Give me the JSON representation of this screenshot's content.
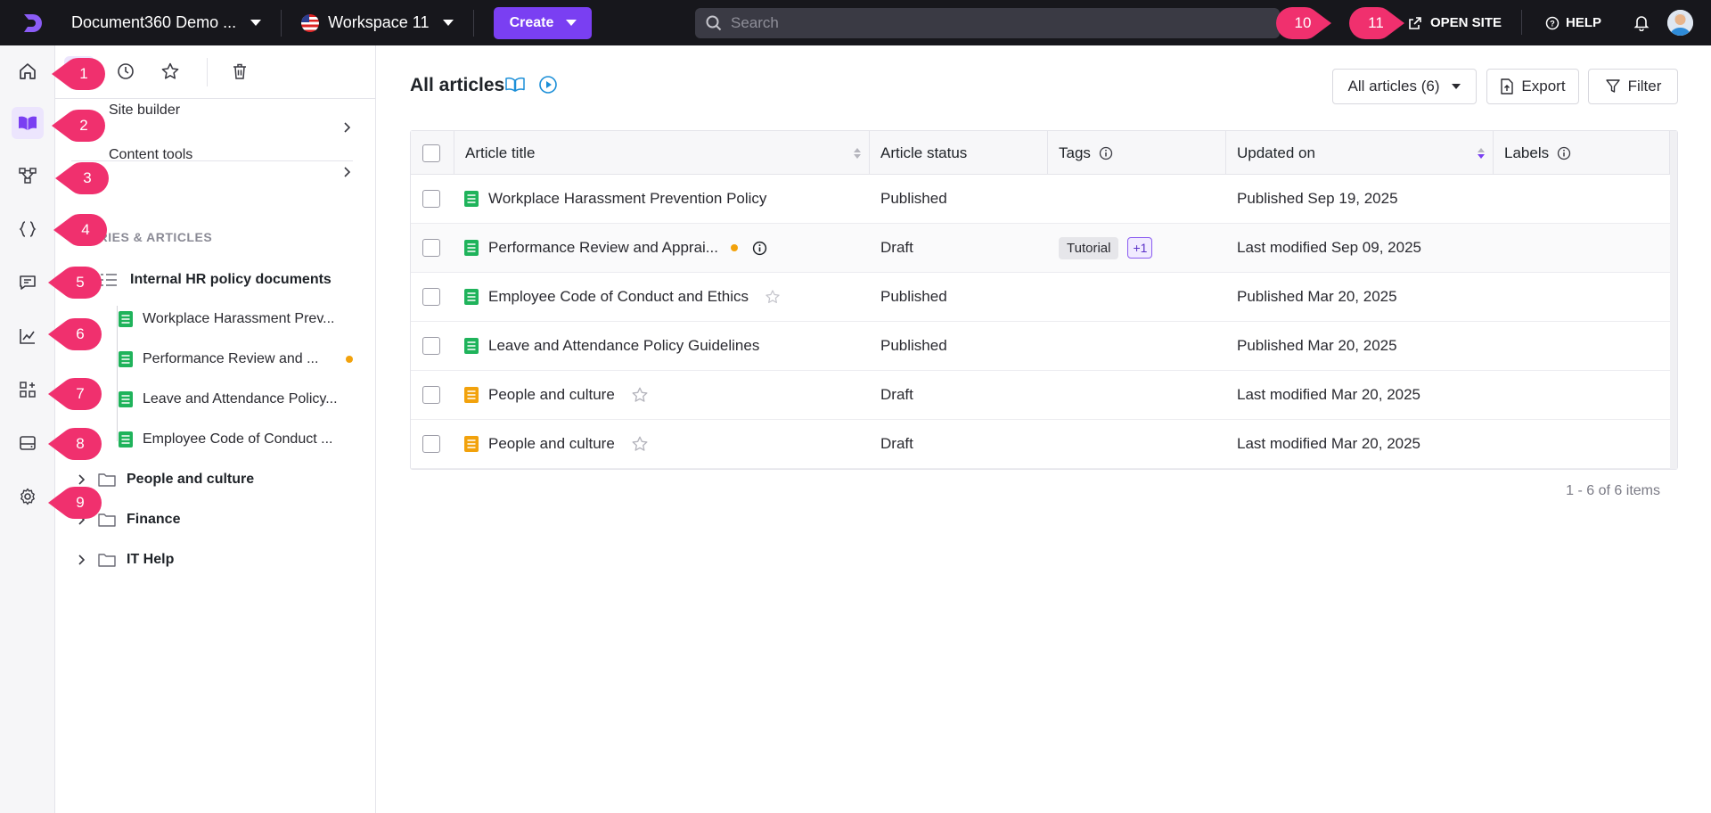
{
  "topbar": {
    "project_name": "Document360 Demo ...",
    "workspace": "Workspace 11",
    "create_label": "Create",
    "search_placeholder": "Search",
    "open_site_label": "OPEN SITE",
    "help_label": "HELP"
  },
  "nav": {
    "site_builder": "Site builder",
    "content_tools": "Content tools",
    "section_label": "EGORIES & ARTICLES",
    "category_main": "Internal HR policy documents",
    "articles": [
      {
        "title": "Workplace Harassment Prev...",
        "dot": false
      },
      {
        "title": "Performance Review and ...",
        "dot": true
      },
      {
        "title": "Leave and Attendance Policy...",
        "dot": false
      },
      {
        "title": "Employee Code of Conduct ...",
        "dot": false
      }
    ],
    "folders": [
      "People and culture",
      "Finance",
      "IT Help"
    ]
  },
  "main": {
    "title": "All articles",
    "filter_dropdown": "All articles (6)",
    "export_label": "Export",
    "filter_label": "Filter",
    "columns": [
      "Article title",
      "Article status",
      "Tags",
      "Updated on",
      "Labels"
    ],
    "rows": [
      {
        "title": "Workplace Harassment Prevention Policy",
        "status": "Published",
        "tags": [],
        "updated": "Published Sep 19, 2025",
        "icon": "green"
      },
      {
        "title": "Performance Review and Apprai...",
        "status": "Draft",
        "tags": [
          "Tutorial",
          "+1"
        ],
        "updated": "Last modified Sep 09, 2025",
        "icon": "green"
      },
      {
        "title": "Employee Code of Conduct and Ethics",
        "status": "Published",
        "tags": [],
        "updated": "Published Mar 20, 2025",
        "icon": "green"
      },
      {
        "title": "Leave and Attendance Policy Guidelines",
        "status": "Published",
        "tags": [],
        "updated": "Published Mar 20, 2025",
        "icon": "green"
      },
      {
        "title": "People and culture",
        "status": "Draft",
        "tags": [],
        "updated": "Last modified Mar 20, 2025",
        "icon": "orange"
      },
      {
        "title": "People and culture",
        "status": "Draft",
        "tags": [],
        "updated": "Last modified Mar 20, 2025",
        "icon": "orange"
      }
    ],
    "pager": "1 - 6 of 6 items"
  },
  "callouts": [
    "1",
    "2",
    "3",
    "4",
    "5",
    "6",
    "7",
    "8",
    "9",
    "10",
    "11"
  ],
  "colors": {
    "accent": "#7a3ff2",
    "callout": "#f0306e",
    "doc_green": "#1fb35b",
    "doc_orange": "#f2a20c"
  }
}
